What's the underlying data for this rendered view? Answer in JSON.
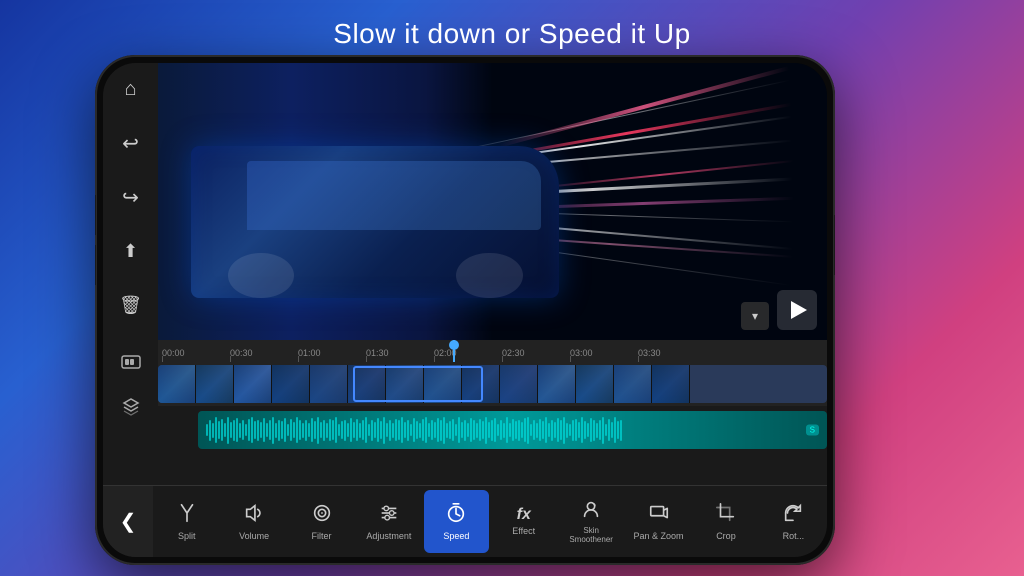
{
  "page": {
    "title": "Slow it down or Speed it Up",
    "bg_gradient": "blue-to-purple-pink"
  },
  "phone": {
    "app": {
      "sidebar": {
        "icons": [
          {
            "name": "home",
            "symbol": "⌂",
            "label": "Home"
          },
          {
            "name": "undo",
            "symbol": "↩",
            "label": "Undo"
          },
          {
            "name": "redo",
            "symbol": "↪",
            "label": "Redo"
          },
          {
            "name": "export",
            "symbol": "⬆",
            "label": "Export"
          },
          {
            "name": "delete",
            "symbol": "🗑",
            "label": "Delete"
          }
        ]
      },
      "video": {
        "playing": false,
        "play_label": "▶"
      },
      "timeline": {
        "ruler_marks": [
          "00:00",
          "00:30",
          "01:00",
          "01:30",
          "02:00",
          "02:30",
          "03:00",
          "03:30"
        ],
        "sidebar_icons": [
          {
            "name": "video-track",
            "symbol": "▦"
          },
          {
            "name": "audio-track",
            "symbol": "◈"
          }
        ]
      },
      "toolbar": {
        "back_label": "❮",
        "items": [
          {
            "id": "split",
            "label": "Split",
            "icon": "✂",
            "active": false
          },
          {
            "id": "volume",
            "label": "Volume",
            "icon": "♪",
            "active": false
          },
          {
            "id": "filter",
            "label": "Filter",
            "icon": "◎",
            "active": false
          },
          {
            "id": "adjustment",
            "label": "Adjustment",
            "icon": "⚙",
            "active": false
          },
          {
            "id": "speed",
            "label": "Speed",
            "icon": "⏱",
            "active": true
          },
          {
            "id": "effect",
            "label": "Effect",
            "icon": "fx",
            "active": false
          },
          {
            "id": "skin-smoothener",
            "label": "Skin\nSmoothener",
            "icon": "☺",
            "active": false
          },
          {
            "id": "pan-zoom",
            "label": "Pan & Zoom",
            "icon": "⬜",
            "active": false
          },
          {
            "id": "crop",
            "label": "Crop",
            "icon": "⬛",
            "active": false
          },
          {
            "id": "rotate",
            "label": "Rot...",
            "icon": "↻",
            "active": false
          }
        ]
      }
    }
  }
}
